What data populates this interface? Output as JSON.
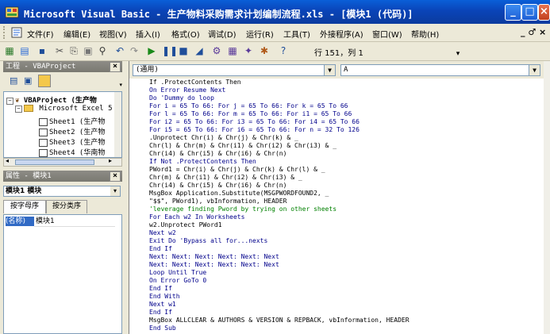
{
  "window": {
    "title": "Microsoft Visual Basic - 生产物料采购需求计划编制流程.xls - [模块1 (代码)]"
  },
  "menu": [
    "文件(F)",
    "编辑(E)",
    "视图(V)",
    "插入(I)",
    "格式(O)",
    "调试(D)",
    "运行(R)",
    "工具(T)",
    "外接程序(A)",
    "窗口(W)",
    "帮助(H)"
  ],
  "toolbar": {
    "cursor_position": "行 151，列 1"
  },
  "project_pane": {
    "title": "工程 - VBAProject",
    "tree": [
      "VBAProject (生产物",
      "Microsoft Excel 5",
      "Sheet1 (生产物",
      "Sheet2 (生产物",
      "Sheet3 (生产物",
      "Sheet4 (华南物"
    ]
  },
  "props_pane": {
    "title": "属性 - 模块1",
    "object_select": "模块1 模块",
    "tabs": [
      "按字母序",
      "按分类序"
    ],
    "property_name": "(名称)",
    "property_value": "模块1"
  },
  "code_window": {
    "object_combo": "(通用)",
    "procedure_combo": "A",
    "lines": [
      {
        "t": "If .ProtectContents Then",
        "c": "#000"
      },
      {
        "t": "On Error Resume Next",
        "c": "#00008b"
      },
      {
        "t": "Do 'Dummy do loop",
        "c": "#00008b"
      },
      {
        "t": "For i = 65 To 66: For j = 65 To 66: For k = 65 To 66",
        "c": "#00008b"
      },
      {
        "t": "For l = 65 To 66: For m = 65 To 66: For i1 = 65 To 66",
        "c": "#00008b"
      },
      {
        "t": "For i2 = 65 To 66: For i3 = 65 To 66: For i4 = 65 To 66",
        "c": "#00008b"
      },
      {
        "t": "For i5 = 65 To 66: For i6 = 65 To 66: For n = 32 To 126",
        "c": "#00008b"
      },
      {
        "t": ".Unprotect Chr(i) & Chr(j) & Chr(k) & _",
        "c": "#000"
      },
      {
        "t": "Chr(l) & Chr(m) & Chr(i1) & Chr(i2) & Chr(i3) & _",
        "c": "#000"
      },
      {
        "t": "Chr(i4) & Chr(i5) & Chr(i6) & Chr(n)",
        "c": "#000"
      },
      {
        "t": "If Not .ProtectContents Then",
        "c": "#00008b"
      },
      {
        "t": "PWord1 = Chr(i) & Chr(j) & Chr(k) & Chr(l) & _",
        "c": "#000"
      },
      {
        "t": "Chr(m) & Chr(i1) & Chr(i2) & Chr(i3) & _",
        "c": "#000"
      },
      {
        "t": "Chr(i4) & Chr(i5) & Chr(i6) & Chr(n)",
        "c": "#000"
      },
      {
        "t": "MsgBox Application.Substitute(MSGPWORDFOUND2, _",
        "c": "#000"
      },
      {
        "t": "\"$$\", PWord1), vbInformation, HEADER",
        "c": "#000"
      },
      {
        "t": "'leverage finding Pword by trying on other sheets",
        "c": "#008000"
      },
      {
        "t": "For Each w2 In Worksheets",
        "c": "#00008b"
      },
      {
        "t": "w2.Unprotect PWord1",
        "c": "#000"
      },
      {
        "t": "Next w2",
        "c": "#00008b"
      },
      {
        "t": "Exit Do 'Bypass all for...nexts",
        "c": "#00008b"
      },
      {
        "t": "End If",
        "c": "#00008b"
      },
      {
        "t": "Next: Next: Next: Next: Next: Next",
        "c": "#00008b"
      },
      {
        "t": "Next: Next: Next: Next: Next: Next",
        "c": "#00008b"
      },
      {
        "t": "Loop Until True",
        "c": "#00008b"
      },
      {
        "t": "On Error GoTo 0",
        "c": "#00008b"
      },
      {
        "t": "End If",
        "c": "#00008b"
      },
      {
        "t": "End With",
        "c": "#00008b"
      },
      {
        "t": "Next w1",
        "c": "#00008b"
      },
      {
        "t": "End If",
        "c": "#00008b"
      },
      {
        "t": "MsgBox ALLCLEAR & AUTHORS & VERSION & REPBACK, vbInformation, HEADER",
        "c": "#000"
      },
      {
        "t": "End Sub",
        "c": "#00008b"
      }
    ]
  }
}
